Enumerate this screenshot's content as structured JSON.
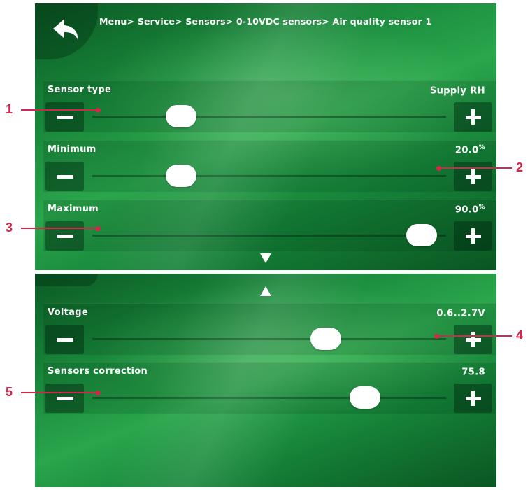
{
  "breadcrumb": "Menu> Service> Sensors> 0-10VDC sensors> Air quality sensor 1",
  "icons": {
    "back": "back-arrow-icon",
    "minus": "minus-icon",
    "plus": "plus-icon",
    "scroll_down": "scroll-down-arrow-icon",
    "scroll_up": "scroll-up-arrow-icon"
  },
  "colors": {
    "callout": "#d6244a",
    "screen_bg": "#1a8a3c",
    "knob": "#ffffff"
  },
  "screen1": {
    "rows": [
      {
        "label": "Sensor type",
        "value": "Supply RH",
        "unit": "",
        "slider_fraction": 0.25
      },
      {
        "label": "Minimum",
        "value": "20.0",
        "unit": "%",
        "slider_fraction": 0.25
      },
      {
        "label": "Maximum",
        "value": "90.0",
        "unit": "%",
        "slider_fraction": 0.93
      }
    ]
  },
  "screen2": {
    "rows": [
      {
        "label": "Voltage",
        "value": "0.6..2.7V",
        "unit": "",
        "slider_fraction": 0.66
      },
      {
        "label": "Sensors correction",
        "value": "75.8",
        "unit": "",
        "slider_fraction": 0.77
      }
    ]
  },
  "callouts": [
    "1",
    "2",
    "3",
    "4",
    "5"
  ]
}
